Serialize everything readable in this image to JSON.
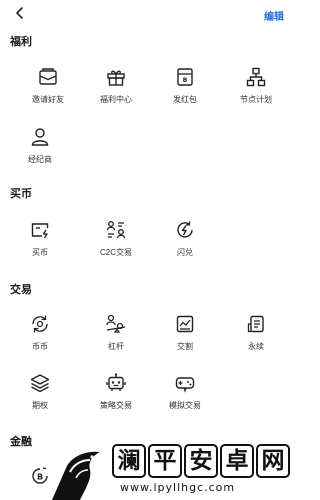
{
  "header": {
    "back_icon": "chevron-left-icon",
    "edit_label": "编辑"
  },
  "sections": {
    "welfare": {
      "title": "福利",
      "items": [
        {
          "label": "邀请好友",
          "icon": "envelope-icon"
        },
        {
          "label": "福利中心",
          "icon": "gift-icon"
        },
        {
          "label": "发红包",
          "icon": "red-packet-icon"
        },
        {
          "label": "节点计划",
          "icon": "node-tree-icon"
        },
        {
          "label": "经纪商",
          "icon": "person-icon"
        }
      ]
    },
    "buy": {
      "title": "买币",
      "items": [
        {
          "label": "买币",
          "icon": "buy-coin-icon"
        },
        {
          "label": "C2C交易",
          "icon": "c2c-icon"
        },
        {
          "label": "闪兑",
          "icon": "flash-swap-icon"
        }
      ]
    },
    "trade": {
      "title": "交易",
      "items": [
        {
          "label": "币币",
          "icon": "coin-exchange-icon"
        },
        {
          "label": "杠杆",
          "icon": "leverage-icon"
        },
        {
          "label": "交割",
          "icon": "delivery-chart-icon"
        },
        {
          "label": "永续",
          "icon": "perpetual-icon"
        },
        {
          "label": "期权",
          "icon": "layers-icon"
        },
        {
          "label": "策略交易",
          "icon": "robot-icon"
        },
        {
          "label": "模拟交易",
          "icon": "gamepad-icon"
        }
      ]
    },
    "finance": {
      "title": "金融",
      "items": [
        {
          "label": "",
          "icon": "bitcoin-icon"
        }
      ]
    }
  },
  "watermark": {
    "chars": [
      "澜",
      "平",
      "安",
      "卓",
      "网"
    ],
    "url": "www.lpyllhgc.com"
  }
}
